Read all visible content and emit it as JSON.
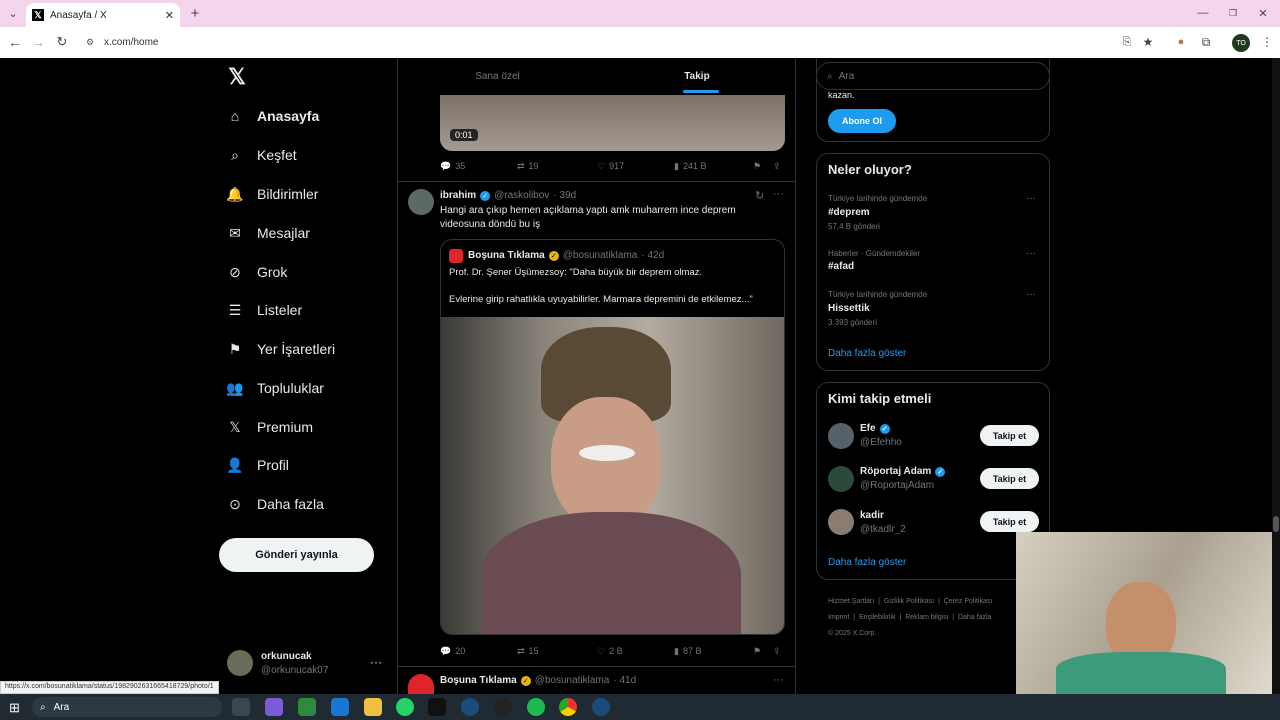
{
  "browser": {
    "tab_title": "Anasayfa / X",
    "url": "x.com/home",
    "status_url": "https://x.com/bosunatiklama/status/1982902631665418729/photo/1",
    "profile_initials": "TO"
  },
  "nav": {
    "items": [
      {
        "label": "Anasayfa",
        "icon": "home-icon"
      },
      {
        "label": "Keşfet",
        "icon": "search-icon"
      },
      {
        "label": "Bildirimler",
        "icon": "bell-icon"
      },
      {
        "label": "Mesajlar",
        "icon": "mail-icon"
      },
      {
        "label": "Grok",
        "icon": "grok-icon"
      },
      {
        "label": "Listeler",
        "icon": "list-icon"
      },
      {
        "label": "Yer İşaretleri",
        "icon": "bookmark-icon"
      },
      {
        "label": "Topluluklar",
        "icon": "communities-icon"
      },
      {
        "label": "Premium",
        "icon": "x-logo-icon"
      },
      {
        "label": "Profil",
        "icon": "profile-icon"
      },
      {
        "label": "Daha fazla",
        "icon": "more-circle-icon"
      }
    ],
    "post_button": "Gönderi yayınla",
    "account_name": "orkunucak",
    "account_handle": "@orkunucak07"
  },
  "timeline": {
    "tabs": [
      "Sana özel",
      "Takip"
    ],
    "video_time": "0:01",
    "prev_actions": {
      "replies": "35",
      "reposts": "19",
      "likes": "917",
      "views": "241 B"
    },
    "tweet1": {
      "name": "ibrahim",
      "handle": "@raskolibov",
      "time": "· 39d",
      "text": "Hangi ara çıkıp hemen açıklama yaptı amk muharrem ince deprem videosuna döndü bu iş",
      "quote": {
        "name": "Boşuna Tıklama",
        "handle": "@bosunatiklama",
        "time": "· 42d",
        "line1": "Prof. Dr. Şener Üşümezsoy: \"Daha büyük bir deprem olmaz.",
        "line2": "Evlerine girip rahatlıkla uyuyabilirler. Marmara depremini de etkilemez...\""
      },
      "actions": {
        "replies": "20",
        "reposts": "15",
        "likes": "2 B",
        "views": "87 B"
      }
    },
    "tweet2": {
      "name": "Boşuna Tıklama",
      "handle": "@bosunatiklama",
      "time": "· 41d"
    }
  },
  "search": {
    "placeholder": "Ara"
  },
  "premium_card": {
    "text": "kazan.",
    "button": "Abone Ol"
  },
  "trends": {
    "title": "Neler oluyor?",
    "items": [
      {
        "context": "Türkiye tarihinde gündemde",
        "name": "#deprem",
        "count": "57,4 B gönderi"
      },
      {
        "context": "Haberler · Gündemdekiler",
        "name": "#afad",
        "count": ""
      },
      {
        "context": "Türkiye tarihinde gündemde",
        "name": "Hissettik",
        "count": "3.393 gönderi"
      }
    ],
    "more": "Daha fazla göster"
  },
  "who_to_follow": {
    "title": "Kimi takip etmeli",
    "items": [
      {
        "name": "Efe",
        "handle": "@Efehho"
      },
      {
        "name": "Röportaj Adam",
        "handle": "@RoportajAdam"
      },
      {
        "name": "kadir",
        "handle": "@tkadlr_2"
      }
    ],
    "follow_label": "Takip et",
    "more": "Daha fazla göster"
  },
  "footer": {
    "links": [
      "Hizmet Şartları",
      "Gizlilik Politikası",
      "Çerez Politikası",
      "Imprint",
      "Erişilebilirlik",
      "Reklam bilgisi",
      "Daha fazla"
    ],
    "copyright": "© 2025 X Corp."
  },
  "taskbar": {
    "search_label": "Ara"
  },
  "colors": {
    "accent": "#1d9bf0",
    "background": "#000000",
    "border": "#2f3336",
    "muted": "#71767b",
    "tabbar": "#f4d6ec"
  }
}
